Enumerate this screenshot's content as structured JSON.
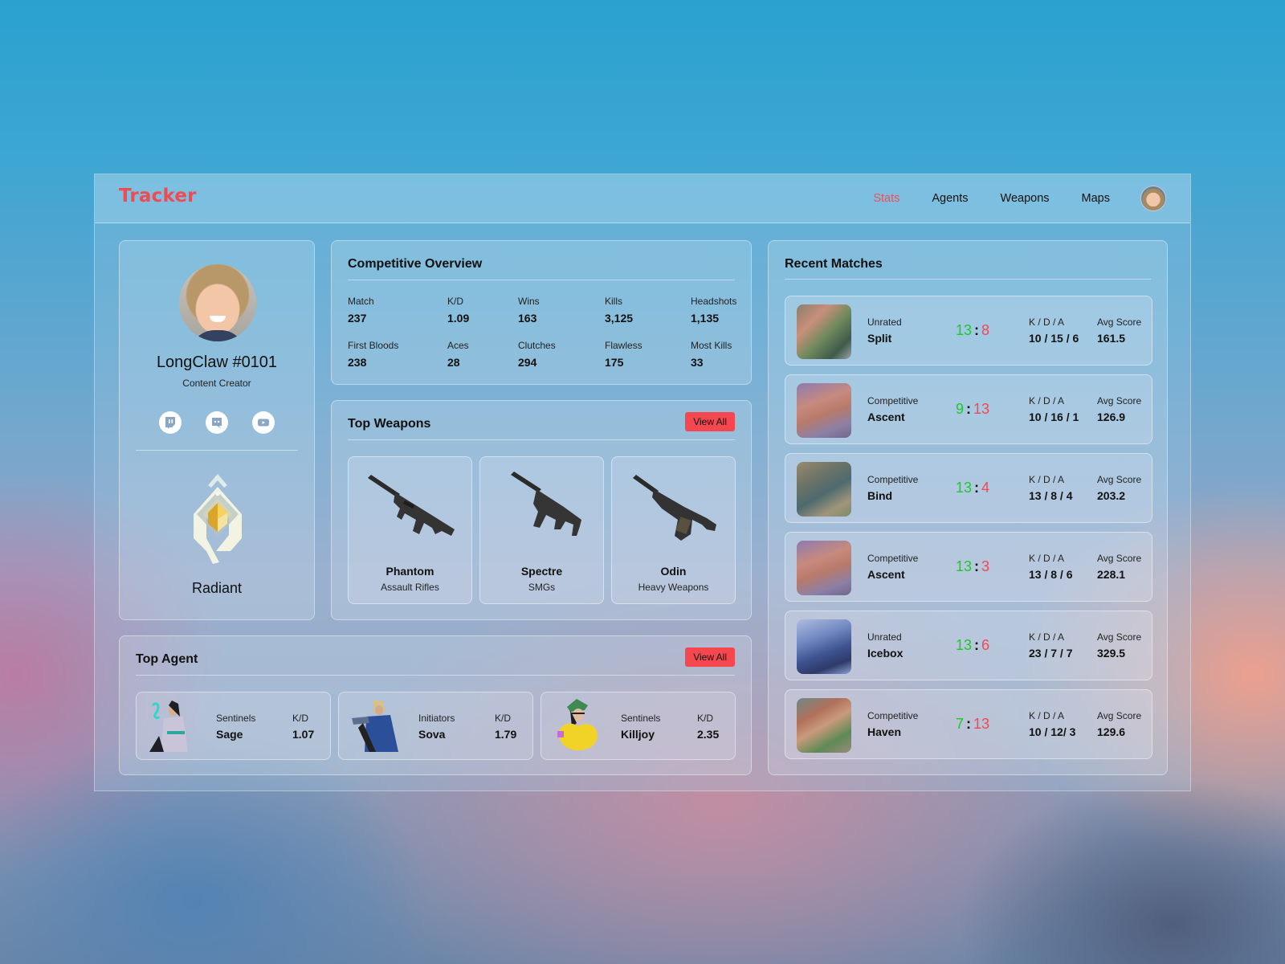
{
  "header": {
    "logo": "Tracker",
    "nav": [
      {
        "label": "Stats",
        "active": true
      },
      {
        "label": "Agents",
        "active": false
      },
      {
        "label": "Weapons",
        "active": false
      },
      {
        "label": "Maps",
        "active": false
      }
    ],
    "accent_color": "#f24a52"
  },
  "profile": {
    "name": "LongClaw #0101",
    "role": "Content Creator",
    "socials": [
      "twitch-icon",
      "discord-icon",
      "youtube-icon"
    ],
    "rank": "Radiant"
  },
  "overview": {
    "title": "Competitive Overview",
    "stats": [
      {
        "label": "Match",
        "value": "237"
      },
      {
        "label": "K/D",
        "value": "1.09"
      },
      {
        "label": "Wins",
        "value": "163"
      },
      {
        "label": "Kills",
        "value": "3,125"
      },
      {
        "label": "Headshots",
        "value": "1,135"
      },
      {
        "label": "First Bloods",
        "value": "238"
      },
      {
        "label": "Aces",
        "value": "28"
      },
      {
        "label": "Clutches",
        "value": "294"
      },
      {
        "label": "Flawless",
        "value": "175"
      },
      {
        "label": "Most Kills",
        "value": "33"
      }
    ]
  },
  "weapons": {
    "title": "Top Weapons",
    "view_all": "View All",
    "items": [
      {
        "name": "Phantom",
        "type": "Assault Rifles"
      },
      {
        "name": "Spectre",
        "type": "SMGs"
      },
      {
        "name": "Odin",
        "type": "Heavy Weapons"
      }
    ]
  },
  "agents": {
    "title": "Top Agent",
    "view_all": "View All",
    "kd_label": "K/D",
    "items": [
      {
        "role": "Sentinels",
        "name": "Sage",
        "kd": "1.07"
      },
      {
        "role": "Initiators",
        "name": "Sova",
        "kd": "1.79"
      },
      {
        "role": "Sentinels",
        "name": "Killjoy",
        "kd": "2.35"
      }
    ]
  },
  "matches": {
    "title": "Recent Matches",
    "kda_label": "K / D / A",
    "avg_label": "Avg Score",
    "win_color": "#1ec92a",
    "loss_color": "#f5474f",
    "items": [
      {
        "mode": "Unrated",
        "map": "Split",
        "score_team": "13",
        "score_enemy": "8",
        "kda": "10 / 15 / 6",
        "avg": "161.5"
      },
      {
        "mode": "Competitive",
        "map": "Ascent",
        "score_team": "9",
        "score_enemy": "13",
        "kda": "10 / 16 / 1",
        "avg": "126.9"
      },
      {
        "mode": "Competitive",
        "map": "Bind",
        "score_team": "13",
        "score_enemy": "4",
        "kda": "13 / 8 / 4",
        "avg": "203.2"
      },
      {
        "mode": "Competitive",
        "map": "Ascent",
        "score_team": "13",
        "score_enemy": "3",
        "kda": "13 / 8 / 6",
        "avg": "228.1"
      },
      {
        "mode": "Unrated",
        "map": "Icebox",
        "score_team": "13",
        "score_enemy": "6",
        "kda": "23 / 7 / 7",
        "avg": "329.5"
      },
      {
        "mode": "Competitive",
        "map": "Haven",
        "score_team": "7",
        "score_enemy": "13",
        "kda": "10 / 12/ 3",
        "avg": "129.6"
      }
    ]
  }
}
